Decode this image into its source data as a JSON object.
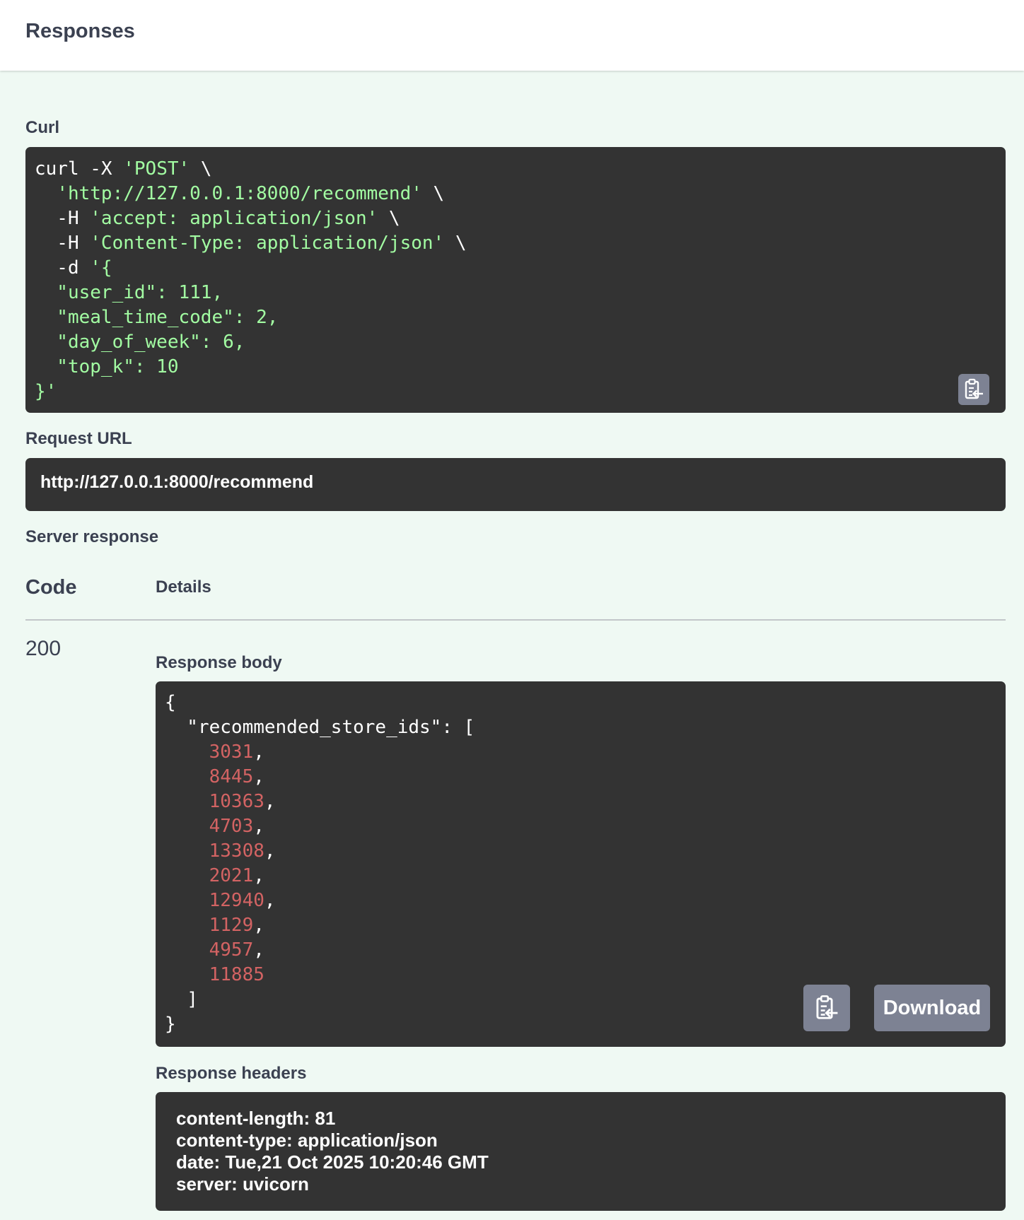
{
  "header": {
    "title": "Responses"
  },
  "curl": {
    "label": "Curl",
    "lines": [
      {
        "plain": "curl -X ",
        "str": "'POST'",
        "tail": " \\"
      },
      {
        "plain": "  ",
        "str": "'http://127.0.0.1:8000/recommend'",
        "tail": " \\"
      },
      {
        "plain": "  -H ",
        "str": "'accept: application/json'",
        "tail": " \\"
      },
      {
        "plain": "  -H ",
        "str": "'Content-Type: application/json'",
        "tail": " \\"
      },
      {
        "plain": "  -d ",
        "str": "'{",
        "tail": ""
      },
      {
        "plain": "",
        "str": "  \"user_id\": 111,",
        "tail": ""
      },
      {
        "plain": "",
        "str": "  \"meal_time_code\": 2,",
        "tail": ""
      },
      {
        "plain": "",
        "str": "  \"day_of_week\": 6,",
        "tail": ""
      },
      {
        "plain": "",
        "str": "  \"top_k\": 10",
        "tail": ""
      },
      {
        "plain": "",
        "str": "}'",
        "tail": ""
      }
    ],
    "copy_icon": "clipboard-copy-icon"
  },
  "request_url": {
    "label": "Request URL",
    "value": "http://127.0.0.1:8000/recommend"
  },
  "server_response": {
    "label": "Server response",
    "col_code": "Code",
    "col_details": "Details",
    "code": "200",
    "body_label": "Response body",
    "body_open": "{",
    "body_key": "  \"recommended_store_ids\": [",
    "ids": [
      "3031",
      "8445",
      "10363",
      "4703",
      "13308",
      "2021",
      "12940",
      "1129",
      "4957",
      "11885"
    ],
    "array_close": "  ]",
    "body_close": "}",
    "download_label": "Download",
    "copy_icon": "clipboard-copy-icon",
    "headers_label": "Response headers",
    "headers": [
      "content-length: 81",
      "content-type: application/json",
      "date: Tue,21 Oct 2025 10:20:46 GMT",
      "server: uvicorn"
    ]
  },
  "colors": {
    "background": "#eff9f3",
    "code_bg": "#333333",
    "string": "#a2fca2",
    "number": "#d36363",
    "button": "#7d8293"
  }
}
